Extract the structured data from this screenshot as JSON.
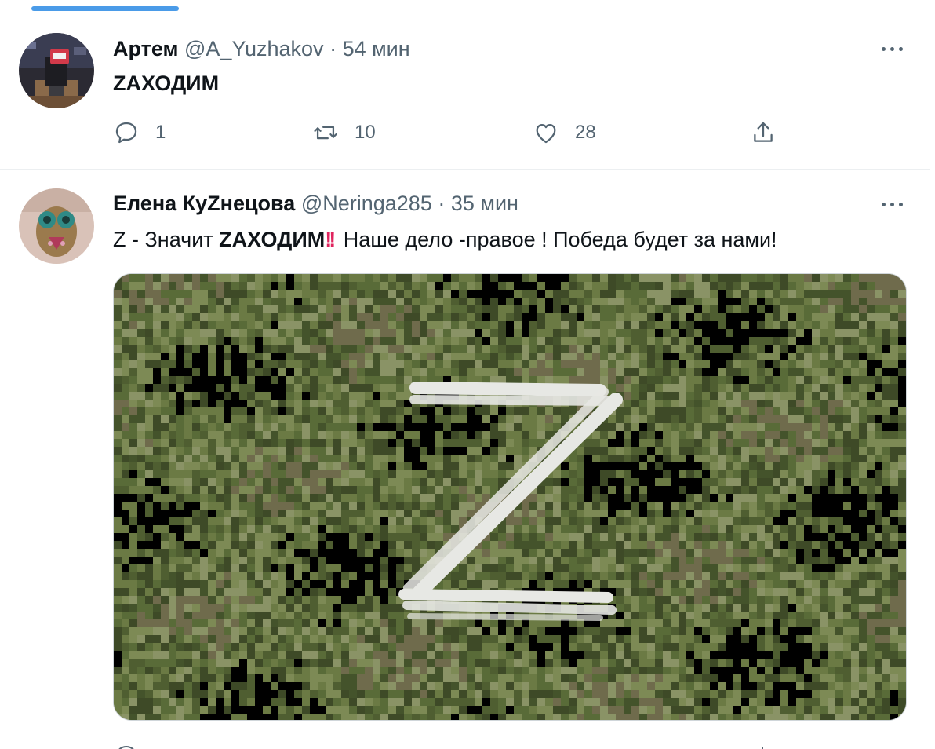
{
  "tweets": [
    {
      "name": "Артем",
      "handle": "@A_Yuzhakov",
      "separator": "·",
      "time": "54 мин",
      "text": "ZАХОДИМ",
      "replies": "1",
      "retweets": "10",
      "likes": "28"
    },
    {
      "name": "Елена КуZнецова",
      "handle": "@Neringa285",
      "separator": "·",
      "time": "35 мин",
      "text_prefix": "Z - Значит ",
      "text_bold": "ZАХОДИМ",
      "text_emoji": "!!",
      "text_suffix": " Наше дело -правое ! Победа будет за нами!",
      "media_letter": "Z"
    }
  ],
  "icons": {
    "reply": "reply-icon",
    "retweet": "retweet-icon",
    "like": "heart-icon",
    "share": "share-icon",
    "more": "more-icon"
  },
  "colors": {
    "accent": "#4a9be8",
    "secondary_text": "#536471",
    "emoji_red": "#e0245e",
    "camo_base": "#5d6d3c"
  }
}
